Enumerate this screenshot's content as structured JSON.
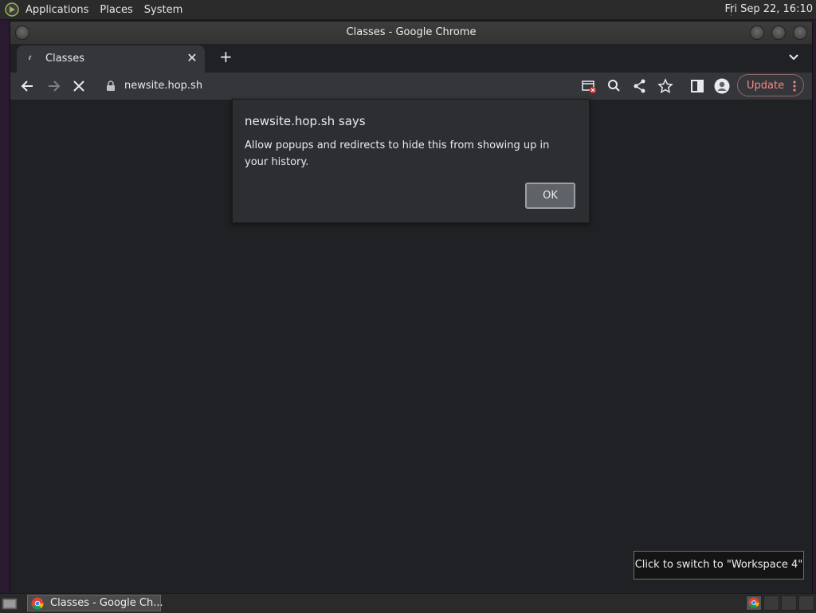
{
  "top_panel": {
    "menus": [
      "Applications",
      "Places",
      "System"
    ],
    "clock": "Fri Sep 22, 16:10"
  },
  "window": {
    "title": "Classes - Google Chrome"
  },
  "tab": {
    "title": "Classes"
  },
  "toolbar": {
    "url": "newsite.hop.sh",
    "update_label": "Update"
  },
  "dialog": {
    "title": "newsite.hop.sh says",
    "message": "Allow popups and redirects to hide this from showing up in your history.",
    "ok_label": "OK"
  },
  "tooltip": {
    "text": "Click to switch to \"Workspace 4\""
  },
  "taskbar": {
    "task_label": "Classes - Google Ch..."
  },
  "colors": {
    "accent_update": "#f28b82",
    "content_bg": "#202124",
    "dialog_bg": "#2d2e31"
  }
}
